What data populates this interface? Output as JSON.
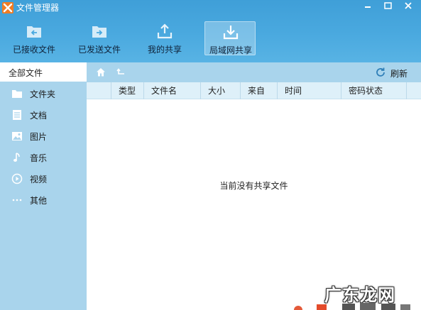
{
  "window": {
    "title": "文件管理器"
  },
  "toolbar": {
    "items": [
      {
        "label": "已接收文件",
        "icon": "received-files-icon",
        "active": false
      },
      {
        "label": "已发送文件",
        "icon": "sent-files-icon",
        "active": false
      },
      {
        "label": "我的共享",
        "icon": "my-share-icon",
        "active": false
      },
      {
        "label": "局域网共享",
        "icon": "lan-share-icon",
        "active": true
      }
    ]
  },
  "sidebar": {
    "all_files": "全部文件",
    "items": [
      {
        "label": "文件夹",
        "icon": "folder-icon"
      },
      {
        "label": "文档",
        "icon": "document-icon"
      },
      {
        "label": "图片",
        "icon": "image-icon"
      },
      {
        "label": "音乐",
        "icon": "music-icon"
      },
      {
        "label": "视频",
        "icon": "video-icon"
      },
      {
        "label": "其他",
        "icon": "more-icon"
      }
    ]
  },
  "nav": {
    "refresh_label": "刷新"
  },
  "table": {
    "columns": [
      "类型",
      "文件名",
      "大小",
      "来自",
      "时间",
      "密码状态"
    ],
    "empty_message": "当前没有共享文件"
  },
  "watermark": {
    "text": "广东龙网"
  },
  "colors": {
    "header_blue": "#4aa9df",
    "sidebar_blue": "#a9d4ec",
    "column_header": "#def0f9",
    "logo_orange": "#f07c24"
  }
}
